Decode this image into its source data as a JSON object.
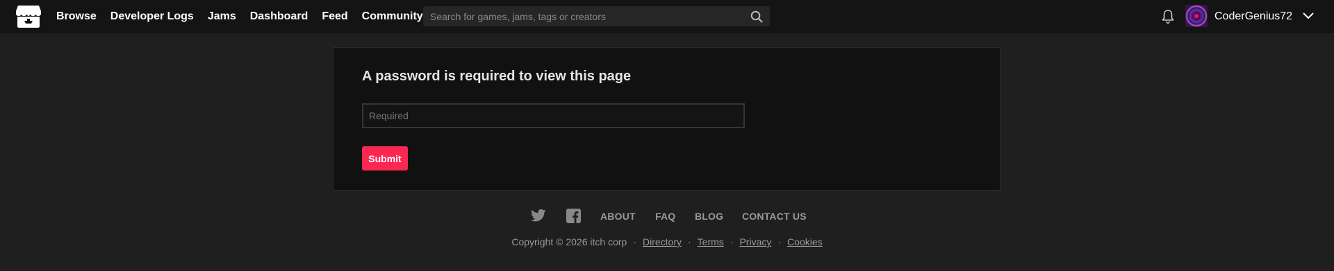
{
  "header": {
    "nav": [
      "Browse",
      "Developer Logs",
      "Jams",
      "Dashboard",
      "Feed",
      "Community"
    ],
    "search_placeholder": "Search for games, jams, tags or creators",
    "username": "CoderGenius72",
    "icons": [
      "itchio-logo-icon",
      "search-icon",
      "bell-icon",
      "avatar",
      "chevron-down-icon"
    ]
  },
  "main": {
    "heading": "A password is required to view this page",
    "password_placeholder": "Required",
    "submit_label": "Submit"
  },
  "footer": {
    "social_icons": [
      "twitter-icon",
      "facebook-icon"
    ],
    "links": [
      "ABOUT",
      "FAQ",
      "BLOG",
      "CONTACT US"
    ],
    "copyright": "Copyright © 2026 itch corp",
    "legal_links": [
      "Directory",
      "Terms",
      "Privacy",
      "Cookies"
    ]
  },
  "colors": {
    "background": "#1f1f1f",
    "header": "#141414",
    "card": "#111111",
    "accent": "#fa2752"
  }
}
